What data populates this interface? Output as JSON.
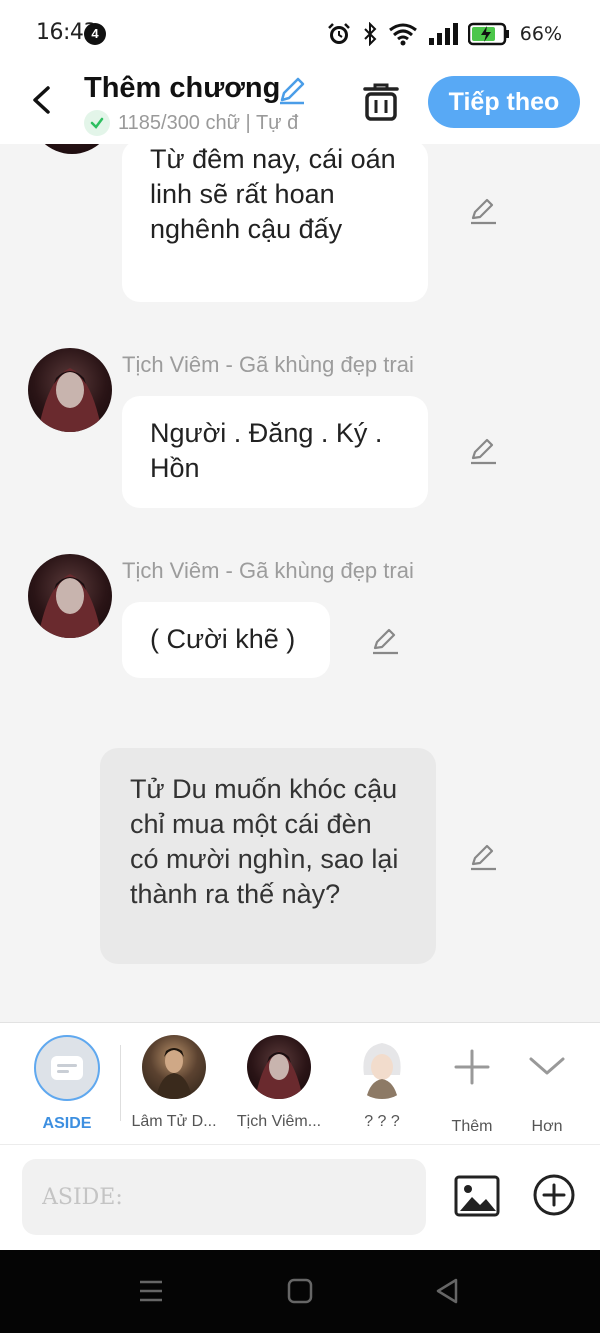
{
  "status": {
    "time": "16:43",
    "notif_count": "4",
    "battery_pct": "66%"
  },
  "header": {
    "title": "Thêm chương",
    "word_count": "1185/300 chữ | Tự đ",
    "next_label": "Tiếp theo",
    "accent": "#58a9f5"
  },
  "messages": [
    {
      "speaker": "",
      "text": "Từ đêm nay, cái oán linh sẽ rất hoan nghênh cậu đấy"
    },
    {
      "speaker": "Tịch Viêm - Gã khùng đẹp trai",
      "text": "Người . Đăng . Ký . Hồn"
    },
    {
      "speaker": "Tịch Viêm - Gã khùng đẹp trai",
      "text": "( Cười khẽ )"
    },
    {
      "speaker": "ASIDE",
      "text": "Tử Du muốn khóc cậu chỉ mua một cái đèn có mười nghìn, sao lại thành ra thế này?"
    }
  ],
  "characters": [
    {
      "name": "ASIDE",
      "selected": true
    },
    {
      "name": "Lâm Tử D..."
    },
    {
      "name": "Tịch Viêm..."
    },
    {
      "name": "? ? ?"
    },
    {
      "name": "Thêm"
    },
    {
      "name": "Hơn"
    }
  ],
  "input": {
    "placeholder": "ASIDE:"
  },
  "icons": [
    "back-icon",
    "pencil-icon",
    "trash-icon",
    "check-icon",
    "plus-icon",
    "chevron-down-icon",
    "image-icon",
    "add-circle-icon"
  ]
}
